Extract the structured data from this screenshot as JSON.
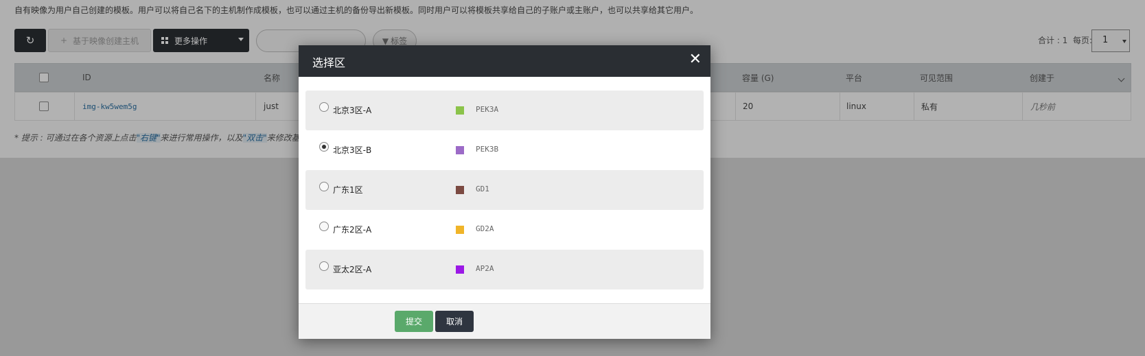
{
  "page": {
    "description": "自有映像为用户自己创建的模板。用户可以将自己名下的主机制作成模板，也可以通过主机的备份导出新模板。同时用户可以将模板共享给自己的子账户或主账户，也可以共享给其它用户。",
    "toolbar": {
      "refresh_icon": "refresh-icon",
      "create_label": "基于映像创建主机",
      "more_label": "更多操作",
      "tag_label": "标签",
      "total_label": "合计 : 1",
      "per_page_label": "每页:",
      "per_page_value": "1"
    },
    "table": {
      "headers": [
        "ID",
        "名称",
        "容量 (G)",
        "平台",
        "可见范围",
        "创建于"
      ],
      "row": {
        "id": "img-kw5wem5g",
        "name": "just",
        "capacity": "20",
        "platform": "linux",
        "visibility": "私有",
        "created": "几秒前"
      }
    },
    "tip": {
      "prefix": "* 提示 : 可通过在各个资源上点击",
      "right_click": "\"右键\"",
      "middle": "来进行常用操作，以及",
      "double_click": "\"双击\"",
      "suffix": "来修改基"
    }
  },
  "modal": {
    "title": "选择区",
    "close_icon": "close-icon",
    "zones": [
      {
        "label": "北京3区-A",
        "code": "PEK3A",
        "color": "#8bc34a",
        "selected": false
      },
      {
        "label": "北京3区-B",
        "code": "PEK3B",
        "color": "#9c6bc7",
        "selected": true
      },
      {
        "label": "广东1区",
        "code": "GD1",
        "color": "#7b4a41",
        "selected": false
      },
      {
        "label": "广东2区-A",
        "code": "GD2A",
        "color": "#f0b429",
        "selected": false
      },
      {
        "label": "亚太2区-A",
        "code": "AP2A",
        "color": "#9b19e6",
        "selected": false
      }
    ],
    "submit_label": "提交",
    "cancel_label": "取消"
  }
}
